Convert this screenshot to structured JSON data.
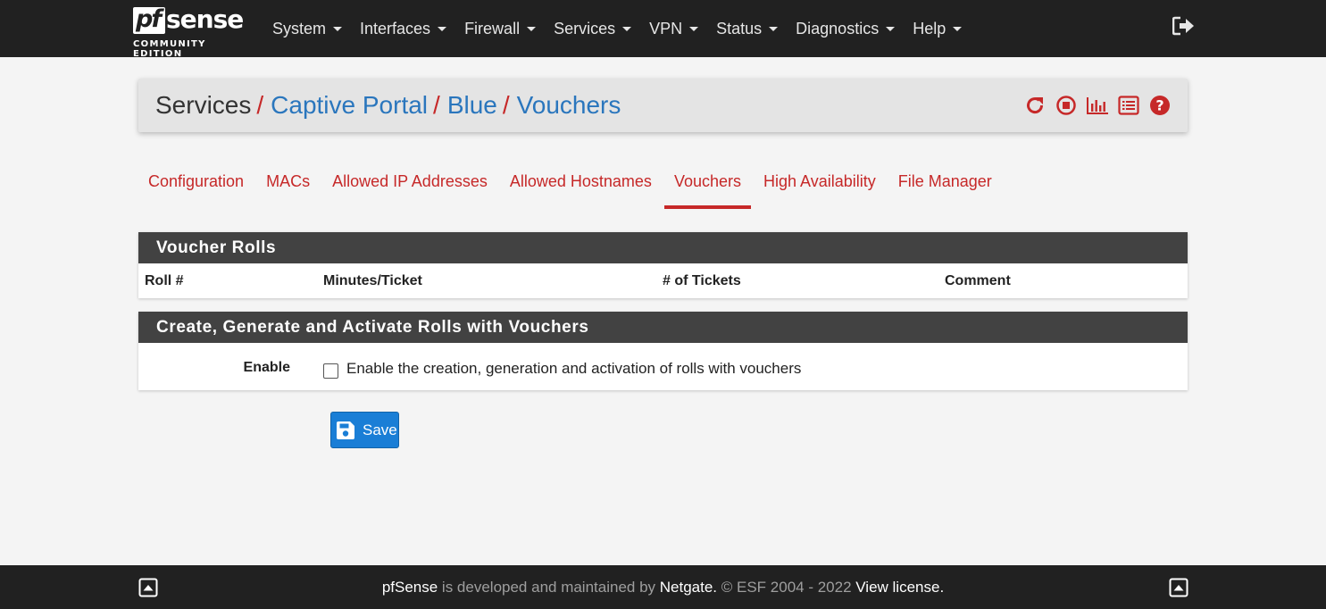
{
  "brand": {
    "logo_pf": "pf",
    "logo_sense": "sense",
    "edition": "COMMUNITY EDITION"
  },
  "nav": {
    "items": [
      {
        "label": "System",
        "icon": "caret-down-icon"
      },
      {
        "label": "Interfaces",
        "icon": "caret-down-icon"
      },
      {
        "label": "Firewall",
        "icon": "caret-down-icon"
      },
      {
        "label": "Services",
        "icon": "caret-down-icon"
      },
      {
        "label": "VPN",
        "icon": "caret-down-icon"
      },
      {
        "label": "Status",
        "icon": "caret-down-icon"
      },
      {
        "label": "Diagnostics",
        "icon": "caret-down-icon"
      },
      {
        "label": "Help",
        "icon": "caret-down-icon"
      }
    ],
    "logout_icon": "sign-out-icon"
  },
  "breadcrumb": {
    "items": [
      "Services",
      "Captive Portal",
      "Blue",
      "Vouchers"
    ],
    "separator": "/",
    "icons": [
      "refresh-icon",
      "stop-icon",
      "chart-icon",
      "list-icon",
      "help-icon"
    ]
  },
  "tabs": [
    {
      "label": "Configuration",
      "active": false
    },
    {
      "label": "MACs",
      "active": false
    },
    {
      "label": "Allowed IP Addresses",
      "active": false
    },
    {
      "label": "Allowed Hostnames",
      "active": false
    },
    {
      "label": "Vouchers",
      "active": true
    },
    {
      "label": "High Availability",
      "active": false
    },
    {
      "label": "File Manager",
      "active": false
    }
  ],
  "voucher_rolls": {
    "title": "Voucher Rolls",
    "columns": [
      "Roll #",
      "Minutes/Ticket",
      "# of Tickets",
      "Comment"
    ]
  },
  "create_panel": {
    "title": "Create, Generate and Activate Rolls with Vouchers",
    "enable_label": "Enable",
    "enable_text": "Enable the creation, generation and activation of rolls with vouchers",
    "enable_checked": false
  },
  "save_button": {
    "label": "Save",
    "icon": "save-icon"
  },
  "footer": {
    "product": "pfSense",
    "text1": " is developed and maintained by ",
    "company": "Netgate.",
    "text2": " © ESF 2004 - 2022 ",
    "license": "View license."
  },
  "colors": {
    "navbar": "#212121",
    "accent_red": "#c62828",
    "link_blue": "#2a76bd",
    "panel_head": "#424242",
    "save_blue": "#1a7ed6"
  }
}
